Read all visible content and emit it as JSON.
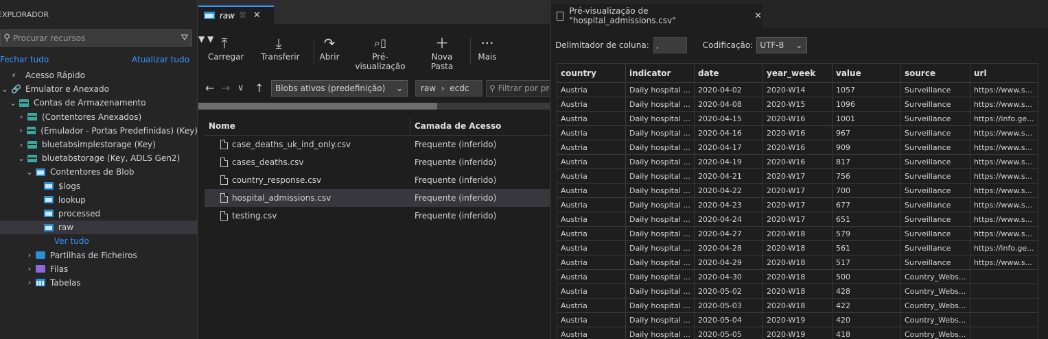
{
  "explorer": {
    "title": "EXPLORADOR",
    "search_placeholder": "Procurar recursos",
    "collapse_all": "Fechar tudo",
    "refresh_all": "Atualizar tudo",
    "tree": [
      {
        "label": "Acesso Rápido",
        "icon": "quick-access-icon",
        "indent": 0,
        "expanded": false,
        "has_chevron": false
      },
      {
        "label": "Emulator e Anexado",
        "icon": "plug-icon",
        "indent": 0,
        "expanded": true,
        "has_chevron": true
      },
      {
        "label": "Contas de Armazenamento",
        "icon": "storage-account-icon",
        "indent": 1,
        "expanded": true,
        "has_chevron": true
      },
      {
        "label": "(Contentores Anexados)",
        "icon": "storage-account-icon",
        "indent": 2,
        "expanded": false,
        "has_chevron": true
      },
      {
        "label": "(Emulador - Portas Predefinidas) (Key)",
        "icon": "storage-account-icon",
        "indent": 2,
        "expanded": false,
        "has_chevron": true
      },
      {
        "label": "bluetabsimplestorage (Key)",
        "icon": "storage-account-icon",
        "indent": 2,
        "expanded": false,
        "has_chevron": true
      },
      {
        "label": "bluetabstorage (Key, ADLS Gen2)",
        "icon": "storage-account-icon",
        "indent": 2,
        "expanded": true,
        "has_chevron": true
      },
      {
        "label": "Contentores de Blob",
        "icon": "blob-container-icon",
        "indent": 3,
        "expanded": true,
        "has_chevron": true
      },
      {
        "label": "$logs",
        "icon": "blob-container-icon",
        "indent": 4,
        "expanded": false,
        "has_chevron": false
      },
      {
        "label": "lookup",
        "icon": "blob-container-icon",
        "indent": 4,
        "expanded": false,
        "has_chevron": false
      },
      {
        "label": "processed",
        "icon": "blob-container-icon",
        "indent": 4,
        "expanded": false,
        "has_chevron": false
      },
      {
        "label": "raw",
        "icon": "blob-container-icon",
        "indent": 4,
        "expanded": false,
        "has_chevron": false,
        "selected": true
      },
      {
        "label": "Ver tudo",
        "icon": "",
        "indent": 5,
        "expanded": false,
        "has_chevron": false,
        "link": true
      },
      {
        "label": "Partilhas de Ficheiros",
        "icon": "file-share-icon",
        "indent": 3,
        "expanded": false,
        "has_chevron": true
      },
      {
        "label": "Filas",
        "icon": "queue-icon",
        "indent": 3,
        "expanded": false,
        "has_chevron": true
      },
      {
        "label": "Tabelas",
        "icon": "table-icon",
        "indent": 3,
        "expanded": false,
        "has_chevron": true
      }
    ]
  },
  "middle": {
    "tab_label": "raw",
    "toolbar": {
      "upload": "Carregar",
      "download": "Transferir",
      "open": "Abrir",
      "preview": "Pré-visualização",
      "new_folder": "Nova Pasta",
      "more": "Mais"
    },
    "view_select": "Blobs ativos (predefinição)",
    "breadcrumb": [
      "raw",
      "ecdc"
    ],
    "filter_placeholder": "Filtrar por pre",
    "progress": 0.68,
    "columns": {
      "name": "Nome",
      "tier": "Camada de Acesso"
    },
    "files": [
      {
        "name": "case_deaths_uk_ind_only.csv",
        "tier": "Frequente (inferido)"
      },
      {
        "name": "cases_deaths.csv",
        "tier": "Frequente (inferido)"
      },
      {
        "name": "country_response.csv",
        "tier": "Frequente (inferido)"
      },
      {
        "name": "hospital_admissions.csv",
        "tier": "Frequente (inferido)",
        "selected": true
      },
      {
        "name": "testing.csv",
        "tier": "Frequente (inferido)"
      }
    ]
  },
  "preview": {
    "tab_title": "Pré-visualização de \"hospital_admissions.csv\"",
    "delimiter_label": "Delimitador de coluna:",
    "delimiter_value": ",",
    "encoding_label": "Codificação:",
    "encoding_value": "UTF-8",
    "columns": [
      "country",
      "indicator",
      "date",
      "year_week",
      "value",
      "source",
      "url"
    ],
    "rows": [
      [
        "Austria",
        "Daily hospital ...",
        "2020-04-02",
        "2020-W14",
        "1057",
        "Surveillance",
        "https://www.s..."
      ],
      [
        "Austria",
        "Daily hospital ...",
        "2020-04-08",
        "2020-W15",
        "1096",
        "Surveillance",
        "https://www.s..."
      ],
      [
        "Austria",
        "Daily hospital ...",
        "2020-04-15",
        "2020-W16",
        "1001",
        "Surveillance",
        "https://info.ge..."
      ],
      [
        "Austria",
        "Daily hospital ...",
        "2020-04-16",
        "2020-W16",
        "967",
        "Surveillance",
        "https://www.s..."
      ],
      [
        "Austria",
        "Daily hospital ...",
        "2020-04-17",
        "2020-W16",
        "909",
        "Surveillance",
        "https://www.s..."
      ],
      [
        "Austria",
        "Daily hospital ...",
        "2020-04-19",
        "2020-W16",
        "817",
        "Surveillance",
        "https://www.s..."
      ],
      [
        "Austria",
        "Daily hospital ...",
        "2020-04-21",
        "2020-W17",
        "756",
        "Surveillance",
        "https://www.s..."
      ],
      [
        "Austria",
        "Daily hospital ...",
        "2020-04-22",
        "2020-W17",
        "700",
        "Surveillance",
        "https://www.s..."
      ],
      [
        "Austria",
        "Daily hospital ...",
        "2020-04-23",
        "2020-W17",
        "677",
        "Surveillance",
        "https://www.s..."
      ],
      [
        "Austria",
        "Daily hospital ...",
        "2020-04-24",
        "2020-W17",
        "651",
        "Surveillance",
        "https://www.s..."
      ],
      [
        "Austria",
        "Daily hospital ...",
        "2020-04-27",
        "2020-W18",
        "579",
        "Surveillance",
        "https://www.s..."
      ],
      [
        "Austria",
        "Daily hospital ...",
        "2020-04-28",
        "2020-W18",
        "561",
        "Surveillance",
        "https://info.ge..."
      ],
      [
        "Austria",
        "Daily hospital ...",
        "2020-04-29",
        "2020-W18",
        "517",
        "Surveillance",
        "https://www.s..."
      ],
      [
        "Austria",
        "Daily hospital ...",
        "2020-04-30",
        "2020-W18",
        "500",
        "Country_Webs...",
        ""
      ],
      [
        "Austria",
        "Daily hospital ...",
        "2020-05-02",
        "2020-W18",
        "428",
        "Country_Webs...",
        ""
      ],
      [
        "Austria",
        "Daily hospital ...",
        "2020-05-03",
        "2020-W18",
        "422",
        "Country_Webs...",
        ""
      ],
      [
        "Austria",
        "Daily hospital ...",
        "2020-05-04",
        "2020-W19",
        "420",
        "Country_Webs...",
        ""
      ],
      [
        "Austria",
        "Daily hospital ...",
        "2020-05-05",
        "2020-W19",
        "418",
        "Country_Webs...",
        ""
      ]
    ]
  },
  "colors": {
    "accent": "#3794ff",
    "selected_row": "#37373d",
    "background": "#1e1e1e"
  }
}
